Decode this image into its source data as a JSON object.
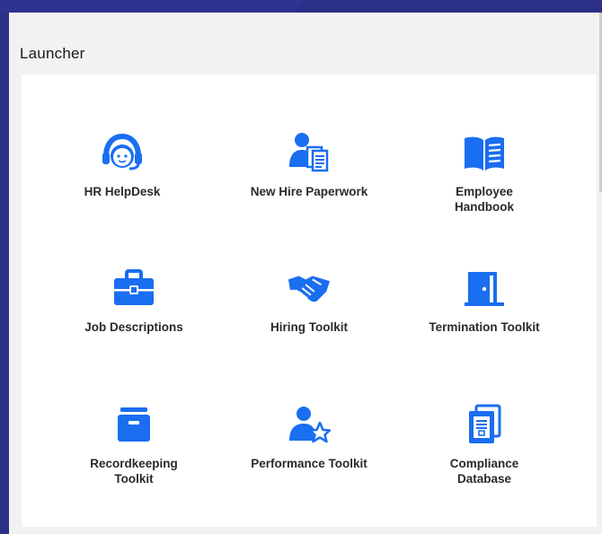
{
  "launcher": {
    "title": "Launcher"
  },
  "accent_color": "#1a6ef0",
  "tiles": [
    {
      "label": "HR HelpDesk",
      "icon": "headset-icon"
    },
    {
      "label": "New Hire Paperwork",
      "icon": "new-hire-icon"
    },
    {
      "label": "Employee\nHandbook",
      "icon": "book-icon"
    },
    {
      "label": "Job Descriptions",
      "icon": "briefcase-icon"
    },
    {
      "label": "Hiring Toolkit",
      "icon": "handshake-icon"
    },
    {
      "label": "Termination Toolkit",
      "icon": "door-icon"
    },
    {
      "label": "Recordkeeping\nToolkit",
      "icon": "file-box-icon"
    },
    {
      "label": "Performance Toolkit",
      "icon": "user-star-icon"
    },
    {
      "label": "Compliance\nDatabase",
      "icon": "document-icon"
    }
  ]
}
